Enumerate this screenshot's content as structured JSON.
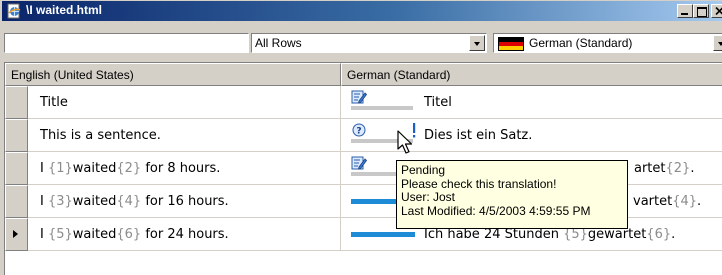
{
  "window": {
    "title": "\\I waited.html"
  },
  "toolbar": {
    "left_filter_value": "",
    "rows_filter": "All Rows",
    "language": "German (Standard)"
  },
  "grid": {
    "columns": [
      "English (United States)",
      "German (Standard)"
    ],
    "rows": [
      {
        "source": [
          {
            "t": "Title"
          }
        ],
        "target": [
          {
            "t": "Titel"
          }
        ],
        "status": "edited-icon",
        "current": false
      },
      {
        "source": [
          {
            "t": "This is a sentence."
          }
        ],
        "target": [
          {
            "t": "Dies ist ein Satz."
          }
        ],
        "status": "pending-icon",
        "current": false
      },
      {
        "source": [
          {
            "t": "I "
          },
          {
            "t": "{1}",
            "tag": true
          },
          {
            "t": "waited"
          },
          {
            "t": "{2}",
            "tag": true
          },
          {
            "t": " for 8 hours."
          }
        ],
        "target": [
          {
            "t": "artet"
          },
          {
            "t": "{2}",
            "tag": true
          },
          {
            "t": "."
          }
        ],
        "status": "edited-icon",
        "current": false
      },
      {
        "source": [
          {
            "t": "I "
          },
          {
            "t": "{3}",
            "tag": true
          },
          {
            "t": "waited"
          },
          {
            "t": "{4}",
            "tag": true
          },
          {
            "t": " for 16 hours."
          }
        ],
        "target": [
          {
            "t": "vartet"
          },
          {
            "t": "{4}",
            "tag": true
          },
          {
            "t": "."
          }
        ],
        "status": "progress-bar",
        "current": false
      },
      {
        "source": [
          {
            "t": "I "
          },
          {
            "t": "{5}",
            "tag": true
          },
          {
            "t": "waited"
          },
          {
            "t": "{6}",
            "tag": true
          },
          {
            "t": " for 24 hours."
          }
        ],
        "target": [
          {
            "t": "Ich habe 24 Stunden "
          },
          {
            "t": "{5}",
            "tag": true
          },
          {
            "t": "gewartet"
          },
          {
            "t": "{6}",
            "tag": true
          },
          {
            "t": "."
          }
        ],
        "status": "progress-bar",
        "current": true
      }
    ]
  },
  "tooltip": {
    "lines": [
      "Pending",
      "Please check this translation!",
      "User: Jost",
      "Last Modified: 4/5/2003 4:59:55 PM"
    ]
  },
  "colors": {
    "titlebar_start": "#0a246a",
    "titlebar_end": "#a6caf0",
    "progress_bar": "#1d8bd6",
    "tag_text": "#8c8c8c",
    "tooltip_bg": "#ffffe1"
  }
}
